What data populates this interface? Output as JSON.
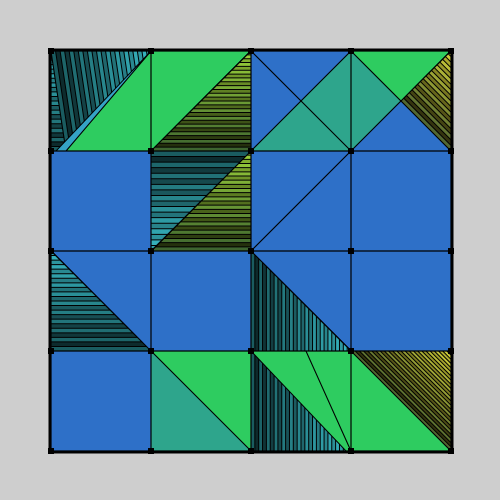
{
  "puzzle": {
    "grid_columns": 4,
    "grid_rows": 4,
    "palette": {
      "background": "#cecece",
      "blue": "#2e70c8",
      "green": "#2ecc60",
      "teal": "#2ea58c",
      "cyan": "#38b9c4",
      "lime": "#9ed43a",
      "yellow": "#d8d63a",
      "line": "#000000"
    },
    "tiles": [
      {
        "row": 0,
        "col": 0,
        "style": "diagonal-band-green-right",
        "fan": "cyan"
      },
      {
        "row": 0,
        "col": 1,
        "style": "half-green-top-left",
        "fan": "lime"
      },
      {
        "row": 0,
        "col": 2,
        "style": "x-split-blue-teal-right"
      },
      {
        "row": 0,
        "col": 3,
        "style": "x-split-teal-green-top",
        "fan": "yellow"
      },
      {
        "row": 1,
        "col": 0,
        "style": "solid-blue"
      },
      {
        "row": 1,
        "col": 1,
        "style": "fan-spiral",
        "fan": "lime"
      },
      {
        "row": 1,
        "col": 2,
        "style": "diagonal-blue"
      },
      {
        "row": 1,
        "col": 3,
        "style": "solid-blue"
      },
      {
        "row": 2,
        "col": 0,
        "style": "fan-left-triangle",
        "fan": "cyan"
      },
      {
        "row": 2,
        "col": 1,
        "style": "solid-blue"
      },
      {
        "row": 2,
        "col": 2,
        "style": "fan-bottom-triangle",
        "fan": "yellow"
      },
      {
        "row": 2,
        "col": 3,
        "style": "solid-blue"
      },
      {
        "row": 3,
        "col": 0,
        "style": "solid-blue"
      },
      {
        "row": 3,
        "col": 1,
        "style": "split-green-teal"
      },
      {
        "row": 3,
        "col": 2,
        "style": "band-green-fan",
        "fan": "cyan"
      },
      {
        "row": 3,
        "col": 3,
        "style": "band-green-yellow-fan",
        "fan": "yellow"
      }
    ]
  }
}
